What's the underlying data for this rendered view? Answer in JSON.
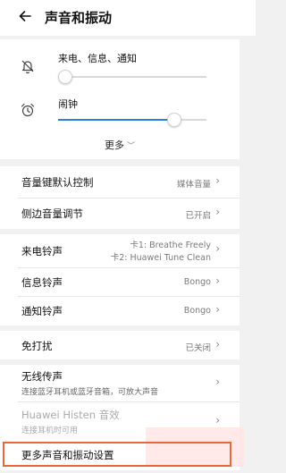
{
  "header": {
    "title": "声音和振动",
    "back_icon": "back-arrow-icon"
  },
  "volume": {
    "ringtone": {
      "label": "来电、信息、通知",
      "icon": "bell-off-icon",
      "level": 0.0
    },
    "alarm": {
      "label": "闹钟",
      "icon": "alarm-clock-icon",
      "level": 0.81,
      "accent": "#2b7fe0"
    },
    "more": {
      "label": "更多"
    }
  },
  "settings": {
    "volume_key": {
      "label": "音量键默认控制",
      "value": "媒体音量"
    },
    "side_volume": {
      "label": "侧边音量调节",
      "value": "已开启"
    },
    "ringtone": {
      "label": "来电铃声",
      "value_line1": "卡1: Breathe Freely",
      "value_line2": "卡2: Huawei Tune Clean"
    },
    "message_tone": {
      "label": "信息铃声",
      "value": "Bongo"
    },
    "notification_tone": {
      "label": "通知铃声",
      "value": "Bongo"
    },
    "dnd": {
      "label": "免打扰",
      "value": "已关闭"
    },
    "wireless_projection": {
      "label": "无线传声",
      "sub": "连接蓝牙耳机或蓝牙音箱，可放大声音"
    },
    "histen": {
      "label": "Huawei Histen 音效",
      "sub": "连接耳机时可用"
    },
    "more_settings": {
      "label": "更多声音和振动设置"
    }
  },
  "colors": {
    "highlight": "#e8683a",
    "accent": "#2b7fe0"
  }
}
